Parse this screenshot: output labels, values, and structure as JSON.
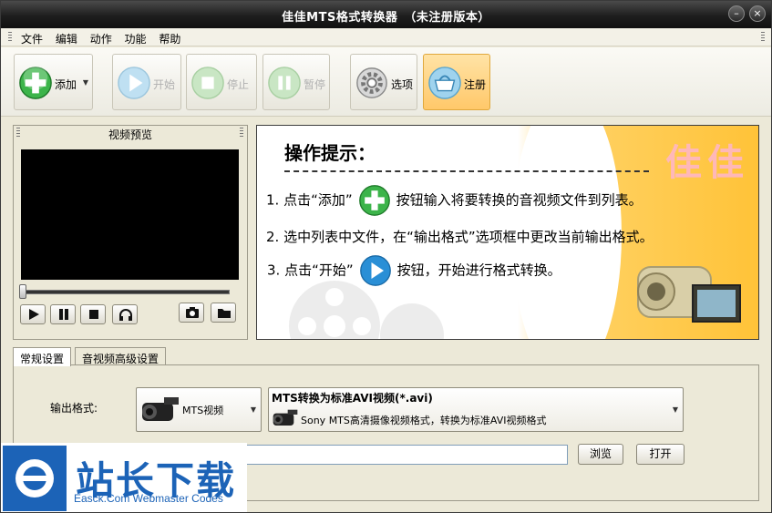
{
  "window": {
    "title": "佳佳MTS格式转换器　（未注册版本）"
  },
  "menu": {
    "items": [
      "文件",
      "编辑",
      "动作",
      "功能",
      "帮助"
    ]
  },
  "toolbar": {
    "add": "添加",
    "start": "开始",
    "stop": "停止",
    "pause": "暂停",
    "options": "选项",
    "register": "注册"
  },
  "preview": {
    "title": "视频预览"
  },
  "tips": {
    "heading": "操作提示：",
    "brand": "佳佳",
    "line1_a": "1. 点击“添加”",
    "line1_b": "按钮输入将要转换的音视频文件到列表。",
    "line2": "2. 选中列表中文件，在“输出格式”选项框中更改当前输出格式。",
    "line3_a": "3. 点击“开始”",
    "line3_b": "按钮，开始进行格式转换。"
  },
  "tabs": {
    "general": "常规设置",
    "advanced": "音视频高级设置"
  },
  "settings": {
    "output_label": "输出格式:",
    "category": "MTS视频",
    "format_title": "MTS转换为标准AVI视频(*.avi)",
    "format_desc": "Sony MTS高清摄像视频格式，转换为标准AVI视频格式",
    "browse": "浏览",
    "open": "打开"
  },
  "watermark": {
    "cn": "站长下载",
    "en": "Easck.Com Webmaster Codes"
  },
  "colors": {
    "accent_green": "#3cb44a",
    "accent_blue": "#2a8fd6",
    "register_bg": "#ffc86a",
    "watermark": "#1c63b7"
  }
}
